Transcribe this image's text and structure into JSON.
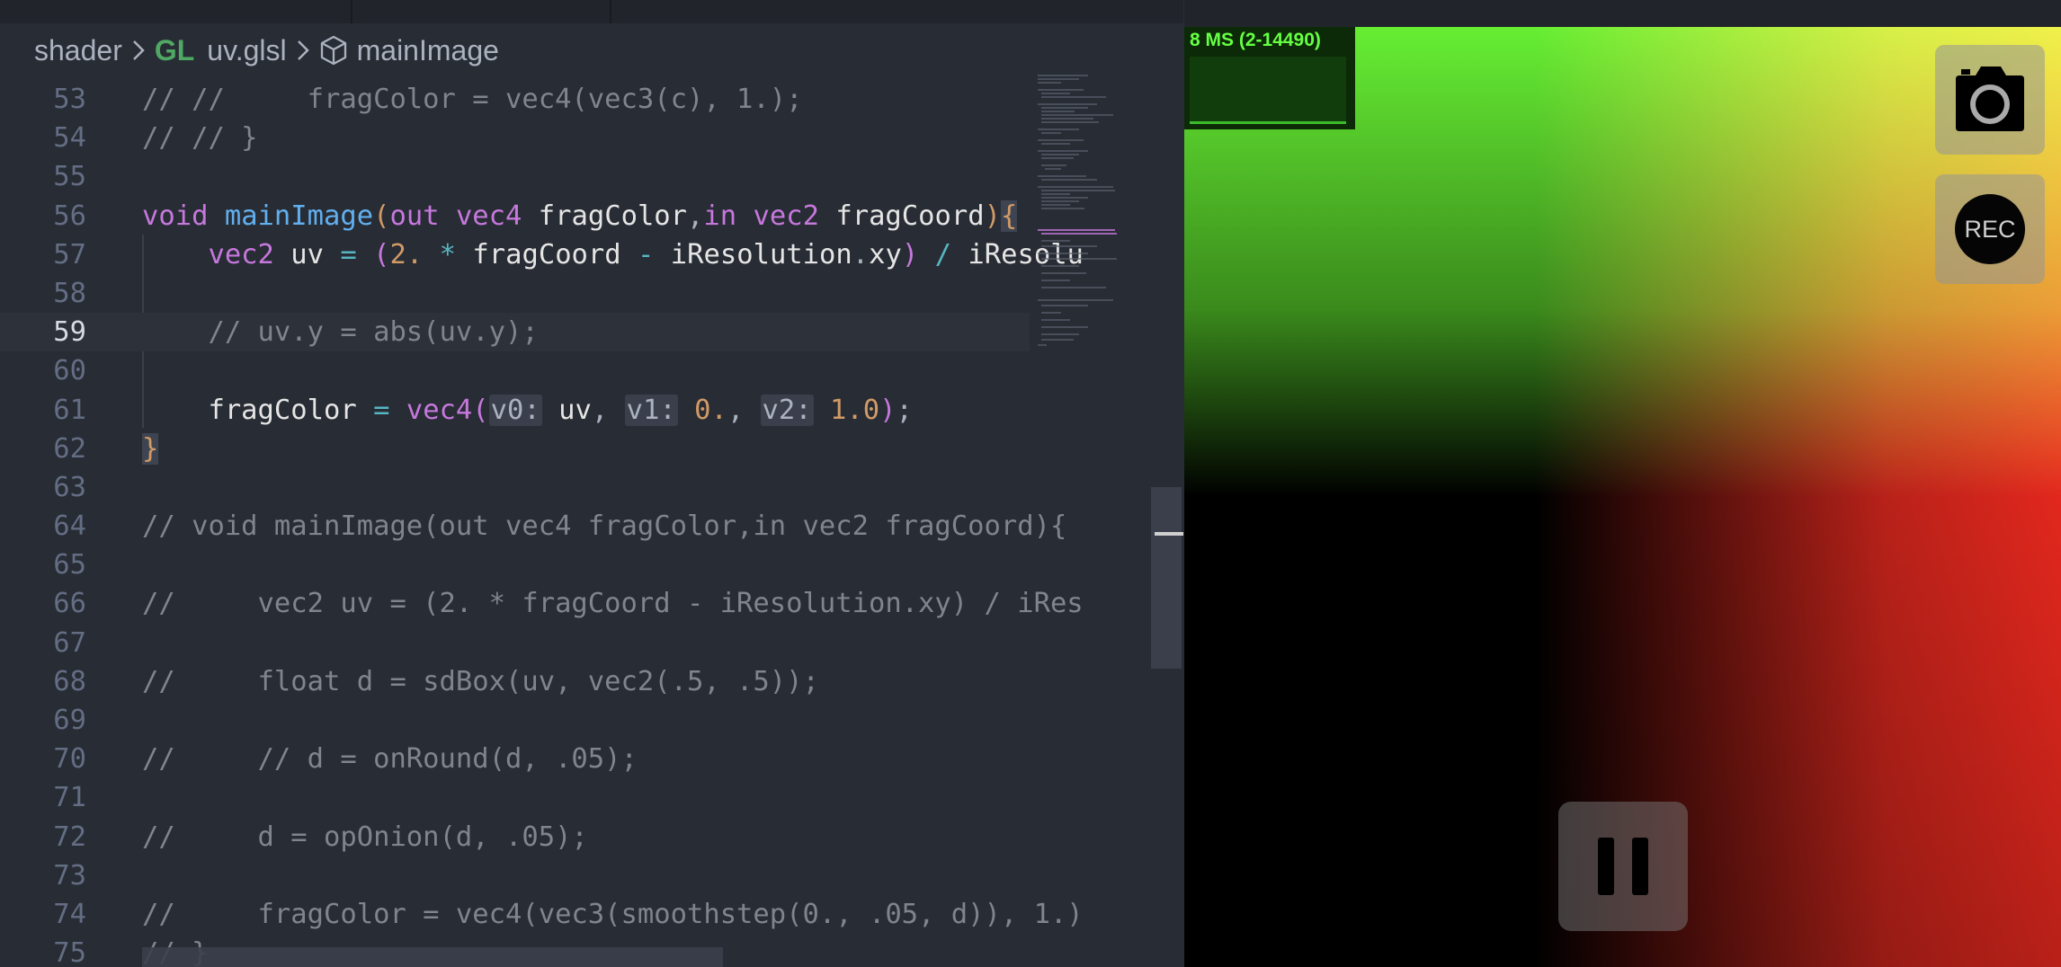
{
  "breadcrumb": {
    "folder": "shader",
    "file_type": "GL",
    "file": "uv.glsl",
    "symbol": "mainImage"
  },
  "editor": {
    "active_line": 59,
    "line_numbers": [
      "53",
      "54",
      "55",
      "56",
      "57",
      "58",
      "59",
      "60",
      "61",
      "62",
      "63",
      "64",
      "65",
      "66",
      "67",
      "68",
      "69",
      "70",
      "71",
      "72",
      "73",
      "74",
      "75"
    ],
    "hints": {
      "v0": "v0:",
      "v1": "v1:",
      "v2": "v2:"
    }
  },
  "preview": {
    "stats": "8 MS (2-14490)",
    "rec_label": "REC"
  },
  "colors": {
    "accent_green": "#66ee33",
    "accent_red": "#e62a1e",
    "editor_bg": "#282c34"
  }
}
